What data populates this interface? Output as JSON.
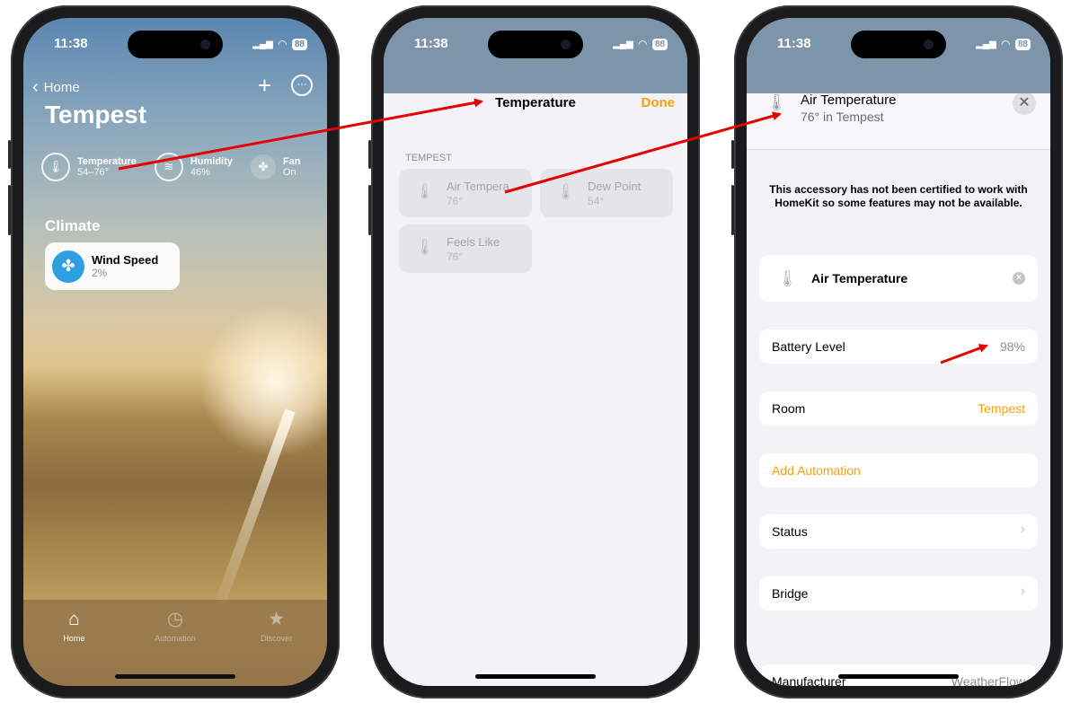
{
  "status": {
    "time": "11:38",
    "battery": "88"
  },
  "phone1": {
    "back_label": "Home",
    "plus_symbol": "+",
    "more_symbol": "···",
    "title": "Tempest",
    "tiles": [
      {
        "name": "Temperature",
        "value": "54–76°",
        "icon": "thermometer-icon"
      },
      {
        "name": "Humidity",
        "value": "46%",
        "icon": "humidity-icon"
      },
      {
        "name": "Fan",
        "value": "On",
        "icon": "fan-icon"
      }
    ],
    "section": "Climate",
    "wind": {
      "name": "Wind Speed",
      "value": "2%",
      "icon": "fan-icon"
    },
    "tabs": [
      {
        "label": "Home",
        "icon": "house-icon"
      },
      {
        "label": "Automation",
        "icon": "clock-icon"
      },
      {
        "label": "Discover",
        "icon": "star-icon"
      }
    ]
  },
  "phone2": {
    "title": "Temperature",
    "done": "Done",
    "group_label": "TEMPEST",
    "accessories": [
      {
        "name": "Air Tempera...",
        "value": "76°"
      },
      {
        "name": "Dew Point",
        "value": "54°"
      },
      {
        "name": "Feels Like",
        "value": "76°"
      }
    ]
  },
  "phone3": {
    "name": "Air Temperature",
    "subtitle": "76° in Tempest",
    "close_symbol": "✕",
    "notice": "This accessory has not been certified to work with HomeKit so some features may not be available.",
    "name_field": "Air Temperature",
    "battery_label": "Battery Level",
    "battery_value": "98%",
    "room_label": "Room",
    "room_value": "Tempest",
    "add_automation": "Add Automation",
    "status_label": "Status",
    "bridge_label": "Bridge",
    "manufacturer_label": "Manufacturer",
    "manufacturer_value": "WeatherFlow"
  },
  "colors": {
    "accent": "#f5a00a",
    "arrow": "#e60000",
    "fan_blue": "#2d9ee0"
  }
}
